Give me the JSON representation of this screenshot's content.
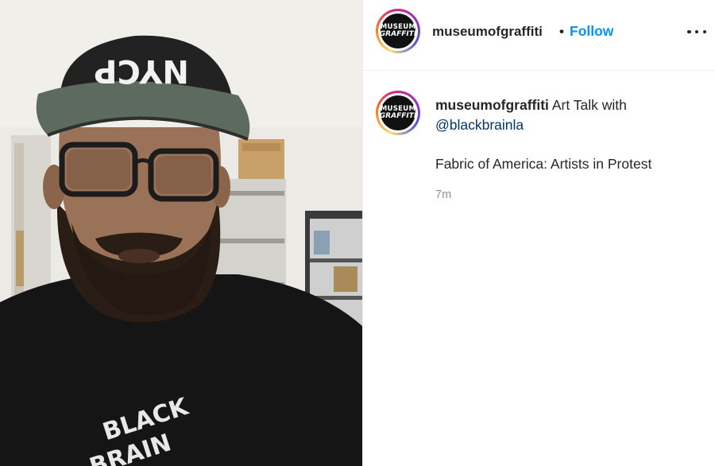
{
  "post": {
    "account": {
      "username": "museumofgraffiti",
      "avatar_text_top": "MUSEUM",
      "avatar_text_bottom": "GRAFFITI"
    },
    "header": {
      "separator": "•",
      "follow_label": "Follow",
      "more_icon": "more-horizontal-icon"
    },
    "caption": {
      "username": "museumofgraffiti",
      "text_before_mention": "Art Talk with",
      "mention": "@blackbrainla",
      "paragraph": "Fabric of America: Artists in Protest",
      "timestamp": "7m"
    },
    "media": {
      "cap_text": "NYCP",
      "shirt_text_top": "BLACK",
      "shirt_text_bottom": "BRAIN"
    }
  },
  "colors": {
    "follow": "#0095f6",
    "mention": "#00376b",
    "timestamp": "#8e8e8e",
    "text": "#262626",
    "divider": "#efefef"
  }
}
